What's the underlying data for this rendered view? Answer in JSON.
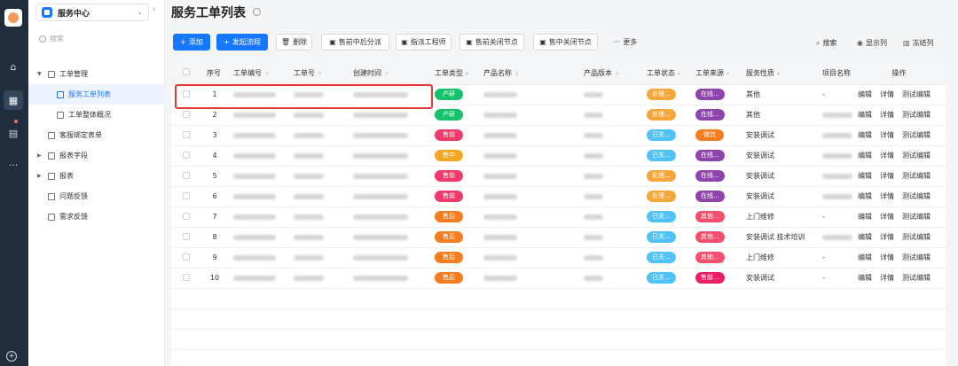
{
  "app": {
    "name": "服务中心",
    "search_placeholder": "搜索"
  },
  "rail": {
    "icons": [
      "home-icon",
      "grid-icon",
      "form-icon",
      "more-icon",
      "add-icon"
    ]
  },
  "sidebar": {
    "items": [
      {
        "label": "工单管理",
        "expanded": true
      },
      {
        "label": "服务工单列表",
        "active": true
      },
      {
        "label": "工单整体概况"
      },
      {
        "label": "客服绑定表单"
      },
      {
        "label": "报表字段"
      },
      {
        "label": "报表"
      },
      {
        "label": "问题反馈"
      },
      {
        "label": "需求反馈"
      }
    ]
  },
  "page": {
    "title": "服务工单列表"
  },
  "toolbar": {
    "add": "添加",
    "start_flow": "发起流程",
    "delete": "删除",
    "pre_sale_assign": "售前中后分派",
    "assign_engineer": "指派工程师",
    "pre_sale_close": "售前关闭节点",
    "mid_sale_close": "售中关闭节点",
    "more": "更多",
    "search": "搜索",
    "show_columns": "显示列",
    "freeze_columns": "冻结列"
  },
  "table": {
    "headers": [
      "序号",
      "工单编号",
      "工单号",
      "创建时间",
      "工单类型",
      "产品名称",
      "产品版本",
      "工单状态",
      "工单来源",
      "服务性质",
      "项目名称",
      "操作"
    ],
    "actions": [
      "编辑",
      "详情",
      "测试编辑"
    ],
    "rows": [
      {
        "no": "1",
        "type": "产研",
        "type_color": "#16c26a",
        "status": "处理...",
        "status_color": "#f7a63b",
        "source": "在线...",
        "source_color": "#8e44ad",
        "nature": "其他",
        "project": "-"
      },
      {
        "no": "2",
        "type": "产研",
        "type_color": "#16c26a",
        "status": "处理...",
        "status_color": "#f7a63b",
        "source": "在线...",
        "source_color": "#8e44ad",
        "nature": "其他",
        "project": ""
      },
      {
        "no": "3",
        "type": "售前",
        "type_color": "#f03a6a",
        "status": "已关...",
        "status_color": "#4fc3f7",
        "source": "微信",
        "source_color": "#f57c1f",
        "nature": "安装调试",
        "project": ""
      },
      {
        "no": "4",
        "type": "售中",
        "type_color": "#f5a623",
        "status": "已关...",
        "status_color": "#4fc3f7",
        "source": "在线...",
        "source_color": "#8e44ad",
        "nature": "安装调试",
        "project": ""
      },
      {
        "no": "5",
        "type": "售前",
        "type_color": "#f03a6a",
        "status": "处理...",
        "status_color": "#f7a63b",
        "source": "在线...",
        "source_color": "#8e44ad",
        "nature": "安装调试",
        "project": ""
      },
      {
        "no": "6",
        "type": "售前",
        "type_color": "#f03a6a",
        "status": "处理...",
        "status_color": "#f7a63b",
        "source": "在线...",
        "source_color": "#8e44ad",
        "nature": "安装调试",
        "project": ""
      },
      {
        "no": "7",
        "type": "售后",
        "type_color": "#f57c1f",
        "status": "已关...",
        "status_color": "#4fc3f7",
        "source": "其他...",
        "source_color": "#f0506e",
        "nature": "上门维修",
        "project": "-"
      },
      {
        "no": "8",
        "type": "售后",
        "type_color": "#f57c1f",
        "status": "已关...",
        "status_color": "#4fc3f7",
        "source": "其他...",
        "source_color": "#f0506e",
        "nature": "安装调试 技术培训",
        "project": ""
      },
      {
        "no": "9",
        "type": "售后",
        "type_color": "#f57c1f",
        "status": "已关...",
        "status_color": "#4fc3f7",
        "source": "其他...",
        "source_color": "#f0506e",
        "nature": "上门维修",
        "project": "-"
      },
      {
        "no": "10",
        "type": "售后",
        "type_color": "#f57c1f",
        "status": "已关...",
        "status_color": "#4fc3f7",
        "source": "售前...",
        "source_color": "#e91e63",
        "nature": "安装调试",
        "project": "-"
      }
    ]
  }
}
